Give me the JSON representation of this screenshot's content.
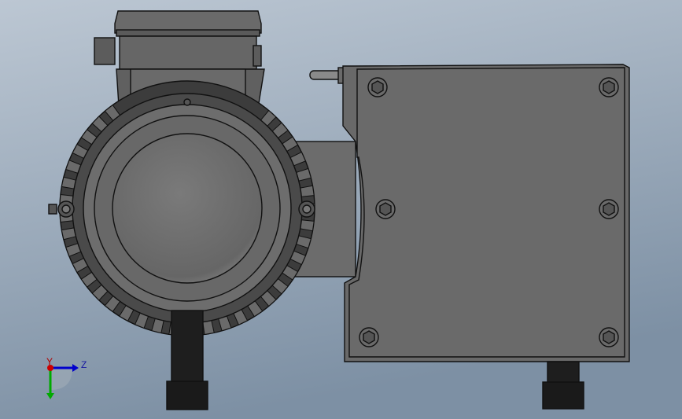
{
  "viewport": {
    "background_top": "#b9c5d1",
    "background_bottom": "#7f92a6"
  },
  "model": {
    "body_color": "#6b6b6b",
    "dark_color": "#444444",
    "edge_color": "#111111",
    "rubber_color": "#1e1e1e"
  },
  "triad": {
    "z_label": "Z",
    "y_label": "Y",
    "x_color": "#cc0000",
    "y_color": "#00aa00",
    "z_color": "#0000cc"
  }
}
